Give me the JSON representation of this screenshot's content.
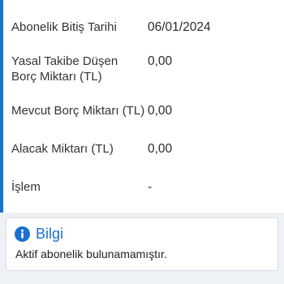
{
  "subscription_info": {
    "rows": [
      {
        "label": "Abonelik Bitiş Tarihi",
        "value": "06/01/2024"
      },
      {
        "label": "Yasal Takibe Düşen Borç Miktarı (TL)",
        "value": "0,00"
      },
      {
        "label": "Mevcut Borç Miktarı (TL)",
        "value": "0,00"
      },
      {
        "label": "Alacak Miktarı (TL)",
        "value": "0,00"
      },
      {
        "label": "İşlem",
        "value": "-"
      }
    ]
  },
  "alert": {
    "title": "Bilgi",
    "message": "Aktif abonelik bulunamamıştır.",
    "icon": "info-icon"
  },
  "colors": {
    "accent_blue": "#1a73c9",
    "info_blue": "#1a6fd1",
    "strip_background": "#eef1f5"
  }
}
